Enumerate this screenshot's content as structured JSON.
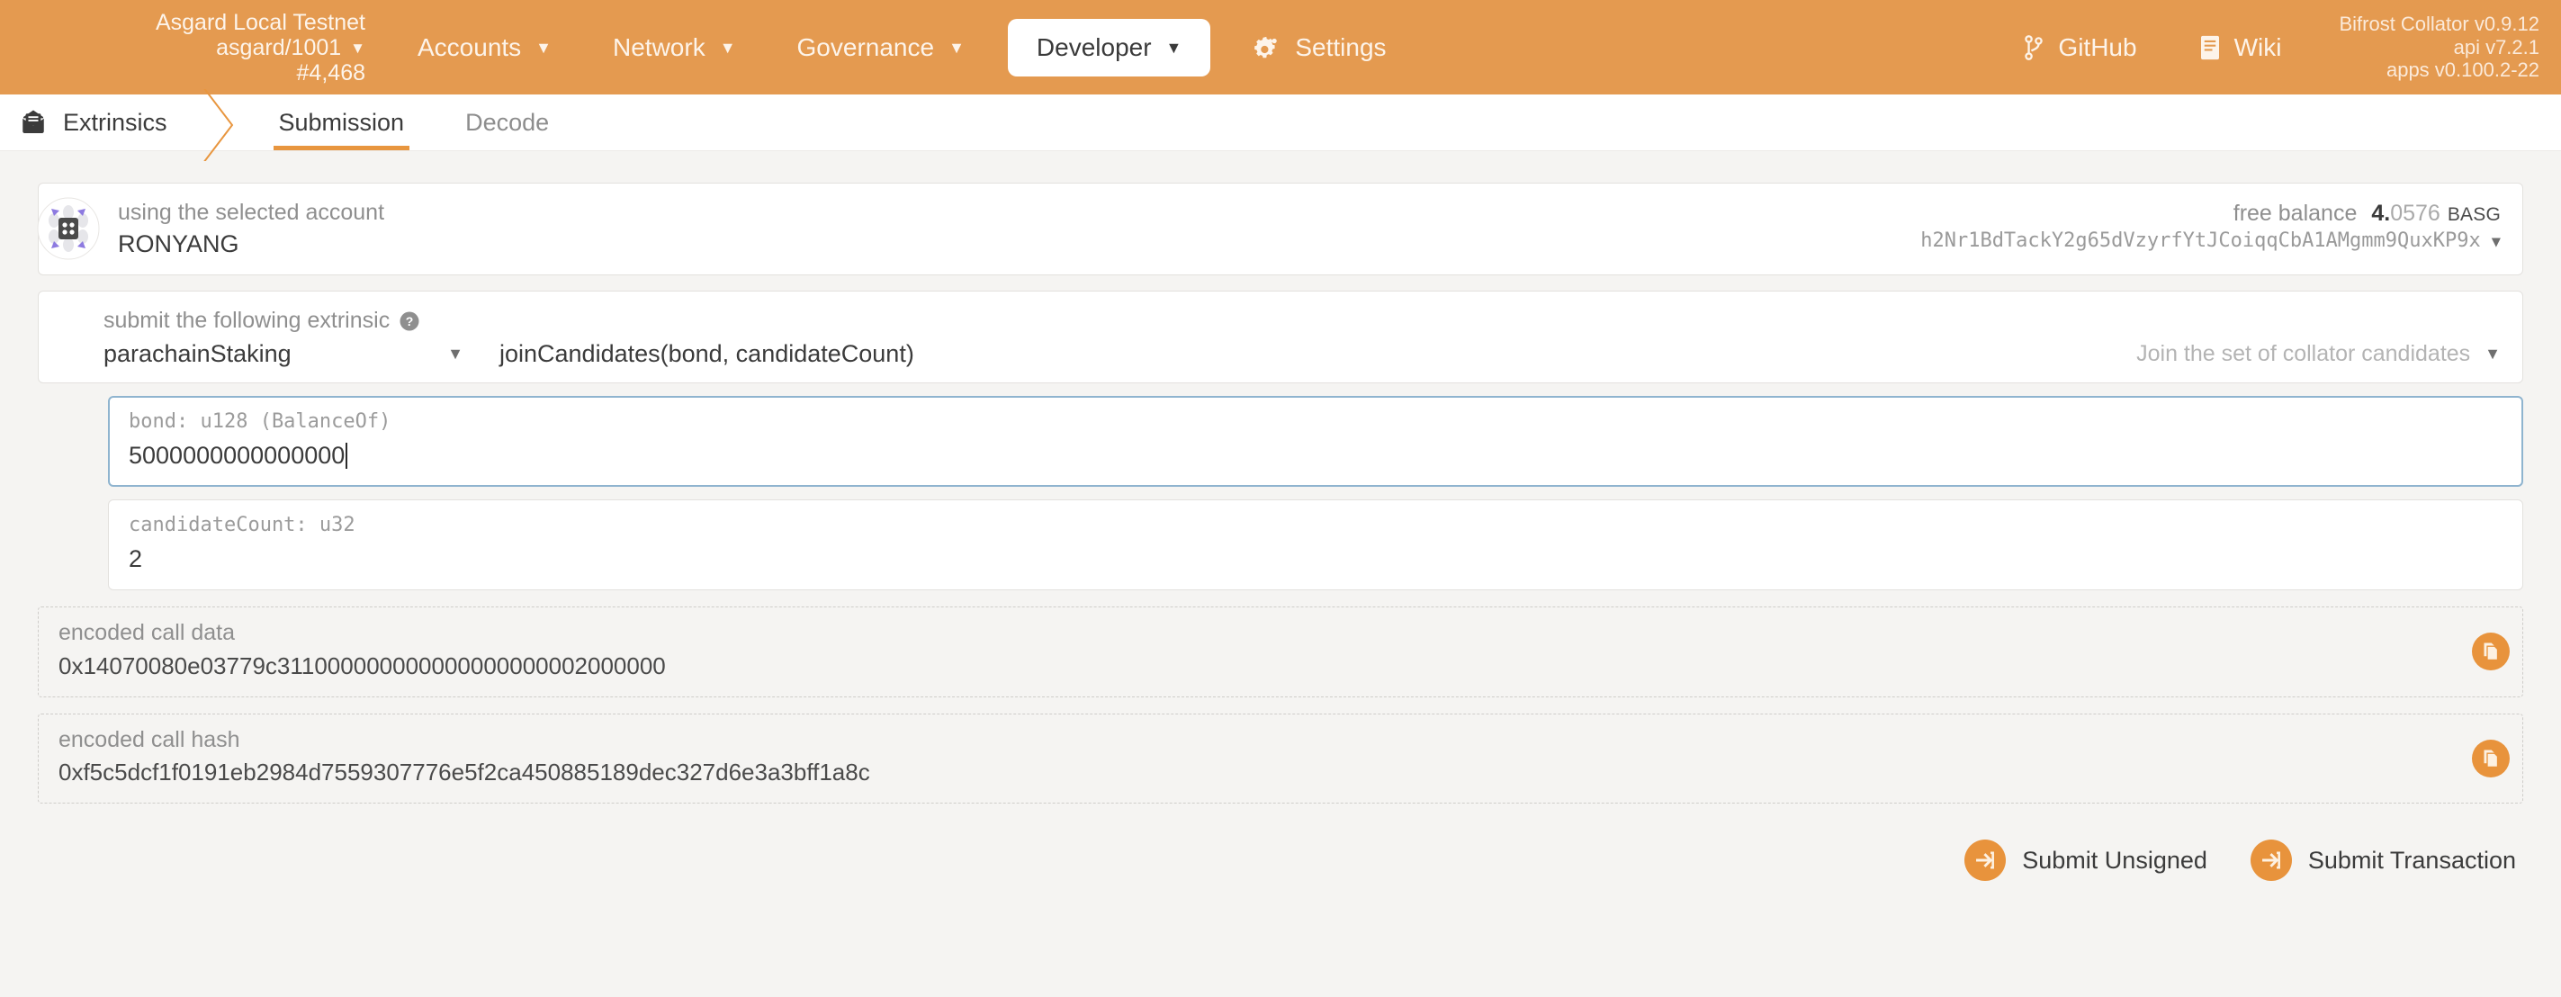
{
  "topbar": {
    "chain": {
      "name": "Asgard Local Testnet",
      "spec": "asgard/1001",
      "block": "#4,468",
      "caret": "▼"
    },
    "nav": [
      {
        "label": "Accounts",
        "caret": "▼",
        "active": false
      },
      {
        "label": "Network",
        "caret": "▼",
        "active": false
      },
      {
        "label": "Governance",
        "caret": "▼",
        "active": false
      },
      {
        "label": "Developer",
        "caret": "▼",
        "active": true
      },
      {
        "label": "Settings",
        "caret": "",
        "icon": "gear-icon",
        "active": false
      }
    ],
    "links": [
      {
        "label": "GitHub",
        "icon": "code-branch-icon"
      },
      {
        "label": "Wiki",
        "icon": "book-icon"
      }
    ],
    "version": {
      "node": "Bifrost Collator v0.9.12",
      "api": "api v7.2.1",
      "apps": "apps v0.100.2-22"
    },
    "accent": "#e49a50"
  },
  "breadcrumb": {
    "icon": "envelope-open-icon",
    "label": "Extrinsics"
  },
  "tabs": [
    {
      "label": "Submission",
      "active": true
    },
    {
      "label": "Decode",
      "active": false
    }
  ],
  "account": {
    "label": "using the selected account",
    "name": "RONYANG",
    "balance_label": "free balance",
    "balance_whole": "4.",
    "balance_frac": "0576",
    "balance_unit": "BASG",
    "address": "h2Nr1BdTackY2g65dVzyrfYtJCoiqqCbA1AMgmm9QuxKP9x",
    "caret": "▼"
  },
  "extrinsic": {
    "label": "submit the following extrinsic",
    "help_icon": "help-circle-icon",
    "module": "parachainStaking",
    "method": "joinCandidates(bond, candidateCount)",
    "method_hint": "Join the set of collator candidates",
    "caret": "▼"
  },
  "params": [
    {
      "label": "bond: u128 (BalanceOf)",
      "value": "5000000000000000",
      "focused": true
    },
    {
      "label": "candidateCount: u32",
      "value": "2",
      "focused": false
    }
  ],
  "encoded": [
    {
      "label": "encoded call data",
      "value": "0x14070080e03779c311000000000000000000002000000",
      "copy_icon": "copy-icon"
    },
    {
      "label": "encoded call hash",
      "value": "0xf5c5dcf1f0191eb2984d7559307776e5f2ca450885189dec327d6e3a3bff1a8c",
      "copy_icon": "copy-icon"
    }
  ],
  "footer": {
    "buttons": [
      {
        "label": "Submit Unsigned",
        "icon": "sign-in-icon"
      },
      {
        "label": "Submit Transaction",
        "icon": "sign-in-icon"
      }
    ]
  }
}
